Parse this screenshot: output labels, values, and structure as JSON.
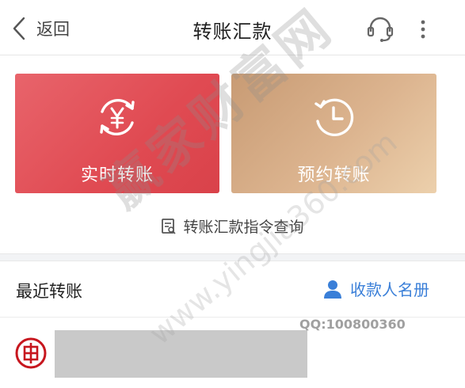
{
  "header": {
    "back_label": "返回",
    "title": "转账汇款",
    "icons": [
      "back-chevron-icon",
      "customer-service-icon",
      "more-icon"
    ]
  },
  "cards": [
    {
      "label": "实时转账",
      "icon": "yuan-cycle-icon",
      "color": "#e04a52"
    },
    {
      "label": "预约转账",
      "icon": "clock-icon",
      "color": "#d7ad86"
    }
  ],
  "query": {
    "label": "转账汇款指令查询",
    "icon": "document-icon"
  },
  "recent": {
    "title": "最近转账",
    "payee_link": "收款人名册",
    "link_color": "#3a7fd8",
    "bank_logo": "icbc-logo-icon"
  },
  "watermark": {
    "text": "赢家财富网",
    "url": "www.yingjia360.com",
    "qq": "QQ:100800360"
  }
}
